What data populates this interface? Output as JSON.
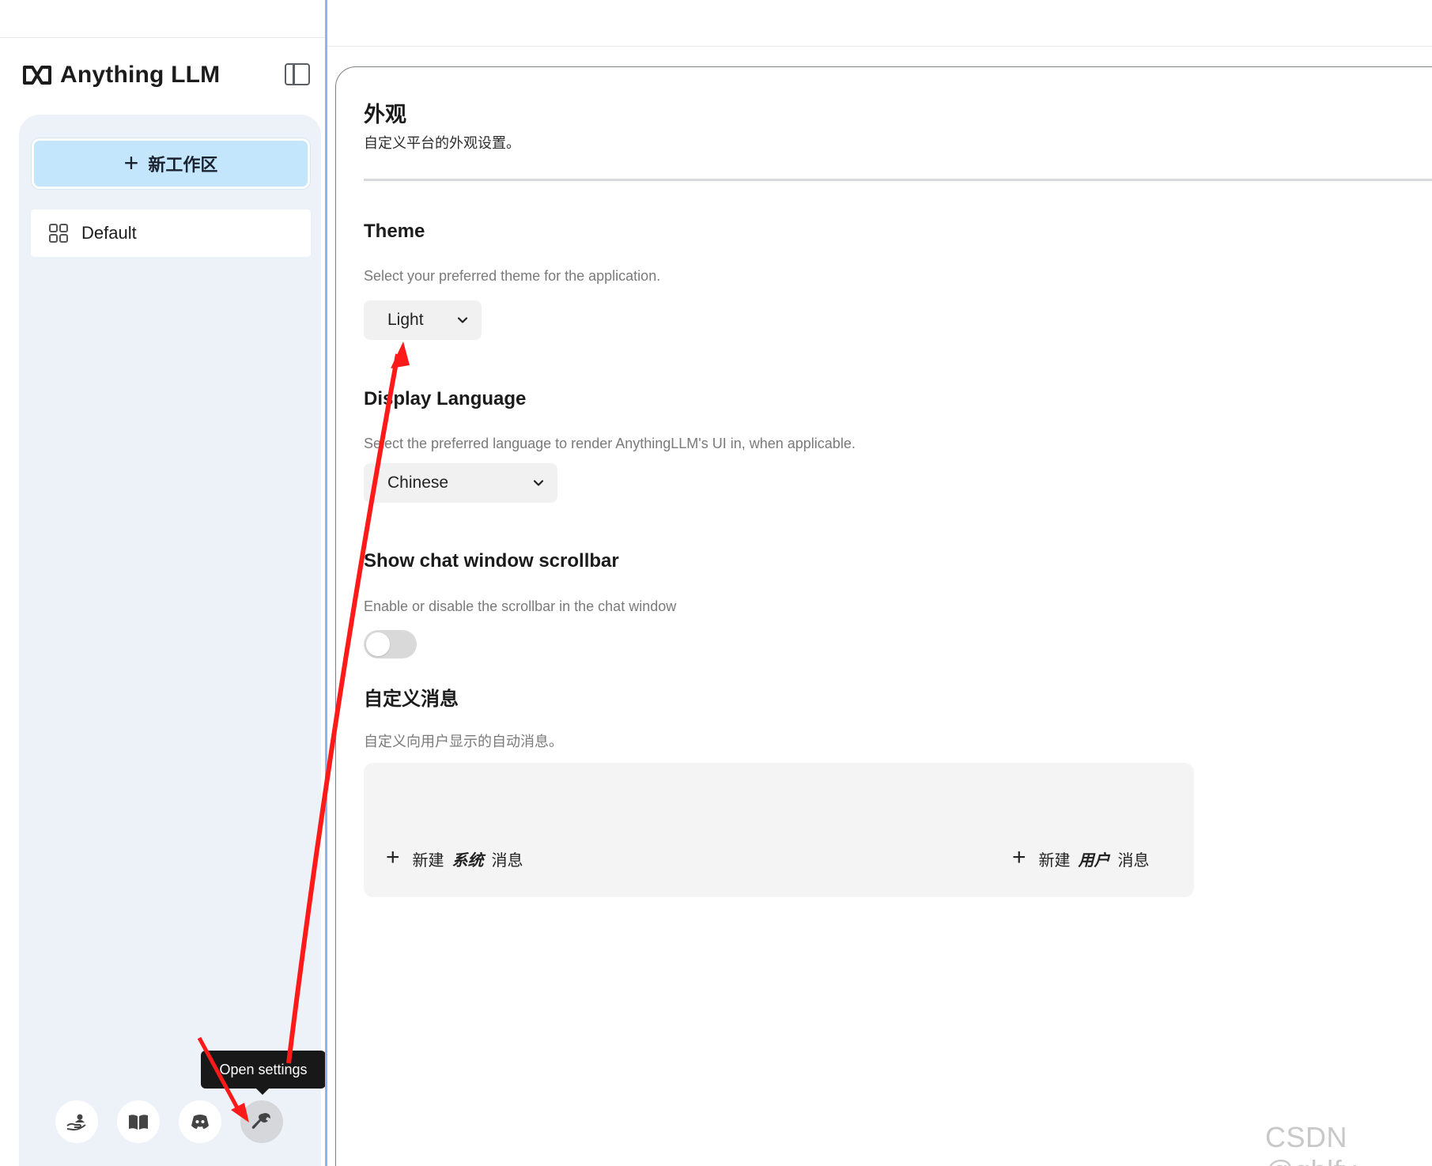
{
  "sidebar": {
    "brand_name": "Anything LLM",
    "new_workspace_label": "新工作区",
    "workspaces": [
      {
        "label": "Default"
      }
    ],
    "tooltip": "Open settings",
    "footer_icons": [
      "community-hub-icon",
      "docs-book-icon",
      "discord-icon",
      "wrench-settings-icon"
    ]
  },
  "main": {
    "title": "外观",
    "description": "自定义平台的外观设置。",
    "theme": {
      "title": "Theme",
      "description": "Select your preferred theme for the application.",
      "selected": "Light"
    },
    "language": {
      "title": "Display Language",
      "description": "Select the preferred language to render AnythingLLM's UI in, when applicable.",
      "selected": "Chinese"
    },
    "scrollbar": {
      "title": "Show chat window scrollbar",
      "description": "Enable or disable the scrollbar in the chat window",
      "enabled": false
    },
    "custom_messages": {
      "title": "自定义消息",
      "description": "自定义向用户显示的自动消息。",
      "new_system": {
        "prefix": "新建",
        "emphasis": "系统",
        "suffix": "消息"
      },
      "new_user": {
        "prefix": "新建",
        "emphasis": "用户",
        "suffix": "消息"
      }
    }
  },
  "watermark": "CSDN @gblfy",
  "colors": {
    "accent_blue": "#c4e6fd",
    "sidebar_bg": "#edf1f8",
    "annotation_red": "#ff1a1a"
  }
}
